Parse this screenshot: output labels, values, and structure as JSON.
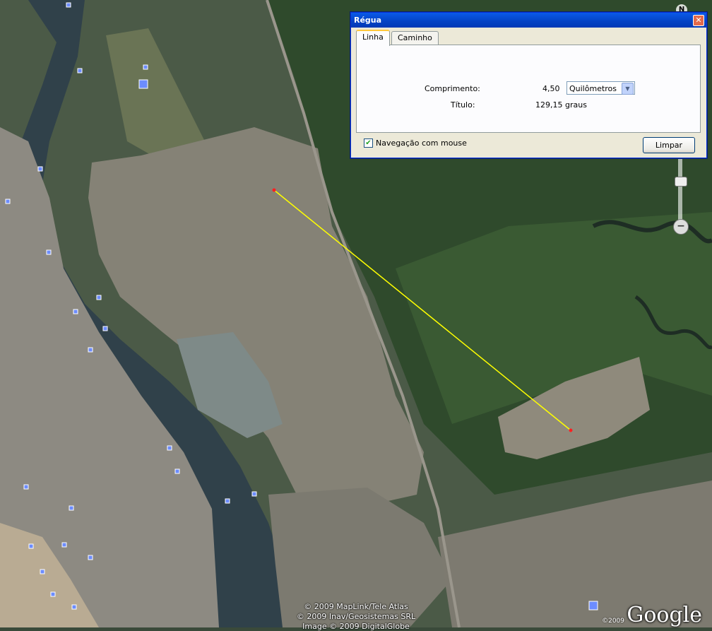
{
  "map": {
    "attribution": [
      "© 2009 MapLink/Tele Atlas",
      "© 2009 Inav/Geosistemas SRL",
      "Image © 2009 DigitalGlobe"
    ],
    "logo": "Google",
    "logo_year": "©2009",
    "compass": "N",
    "zoom_minus": "−",
    "colors": {
      "water": "#30414a",
      "forest": "#2f4a2c",
      "urban": "#8d8a82",
      "ruler_line": "#ffff00",
      "marker": "#ff2020",
      "placemark": "#6c8cff"
    }
  },
  "dialog": {
    "title": "Régua",
    "close": "✕",
    "tabs": [
      {
        "label": "Linha",
        "active": true
      },
      {
        "label": "Caminho",
        "active": false
      }
    ],
    "length_label": "Comprimento:",
    "length_value": "4,50",
    "unit_selected": "Quilômetros",
    "heading_label": "Título:",
    "heading_value": "129,15 graus",
    "mouse_nav_checked": true,
    "mouse_nav_label": "Navegação com mouse",
    "clear_button": "Limpar"
  }
}
